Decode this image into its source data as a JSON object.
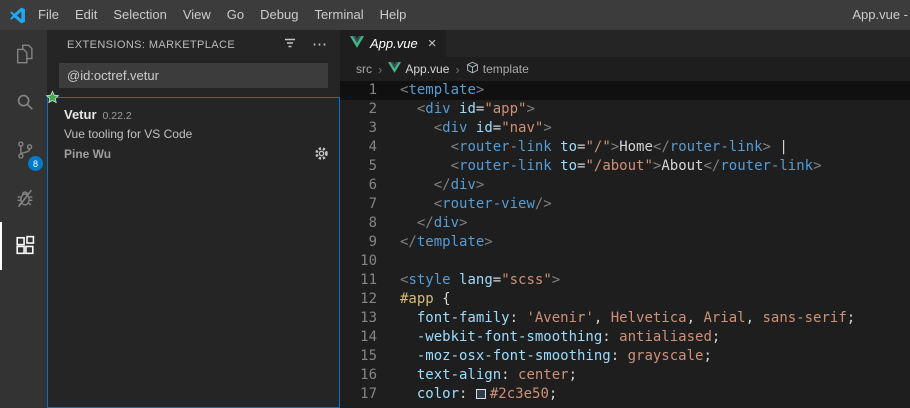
{
  "window": {
    "title": "App.vue -"
  },
  "menu": {
    "items": [
      "File",
      "Edit",
      "Selection",
      "View",
      "Go",
      "Debug",
      "Terminal",
      "Help"
    ]
  },
  "activity_bar": {
    "items": [
      "explorer",
      "search",
      "source-control",
      "debug",
      "extensions"
    ],
    "active_item": "extensions",
    "source_control_badge": "8"
  },
  "sidebar": {
    "title": "EXTENSIONS: MARKETPLACE",
    "search_value": "@id:octref.vetur",
    "extension": {
      "name": "Vetur",
      "version": "0.22.2",
      "description": "Vue tooling for VS Code",
      "author": "Pine Wu"
    }
  },
  "ui_glyphs": {
    "more": "⋯",
    "close": "×",
    "chevron": "›"
  },
  "editor": {
    "tab_label": "App.vue",
    "breadcrumb": {
      "folder": "src",
      "file": "App.vue",
      "symbol": "template"
    },
    "lines": [
      {
        "n": "1",
        "highlight": true,
        "tokens": [
          [
            "p",
            "<"
          ],
          [
            "tag",
            "template"
          ],
          [
            "p",
            ">"
          ]
        ]
      },
      {
        "n": "2",
        "tokens": [
          [
            "pl",
            "  "
          ],
          [
            "p",
            "<"
          ],
          [
            "tag",
            "div"
          ],
          [
            "pl",
            " "
          ],
          [
            "attr",
            "id"
          ],
          [
            "pl",
            "="
          ],
          [
            "str",
            "\"app\""
          ],
          [
            "p",
            ">"
          ]
        ]
      },
      {
        "n": "3",
        "tokens": [
          [
            "pl",
            "    "
          ],
          [
            "p",
            "<"
          ],
          [
            "tag",
            "div"
          ],
          [
            "pl",
            " "
          ],
          [
            "attr",
            "id"
          ],
          [
            "pl",
            "="
          ],
          [
            "str",
            "\"nav\""
          ],
          [
            "p",
            ">"
          ]
        ]
      },
      {
        "n": "4",
        "tokens": [
          [
            "pl",
            "      "
          ],
          [
            "p",
            "<"
          ],
          [
            "tag",
            "router-link"
          ],
          [
            "pl",
            " "
          ],
          [
            "attr",
            "to"
          ],
          [
            "pl",
            "="
          ],
          [
            "str",
            "\"/\""
          ],
          [
            "p",
            ">"
          ],
          [
            "pl",
            "Home"
          ],
          [
            "p",
            "</"
          ],
          [
            "tag",
            "router-link"
          ],
          [
            "p",
            ">"
          ],
          [
            "pl",
            " |"
          ]
        ]
      },
      {
        "n": "5",
        "tokens": [
          [
            "pl",
            "      "
          ],
          [
            "p",
            "<"
          ],
          [
            "tag",
            "router-link"
          ],
          [
            "pl",
            " "
          ],
          [
            "attr",
            "to"
          ],
          [
            "pl",
            "="
          ],
          [
            "str",
            "\"/about\""
          ],
          [
            "p",
            ">"
          ],
          [
            "pl",
            "About"
          ],
          [
            "p",
            "</"
          ],
          [
            "tag",
            "router-link"
          ],
          [
            "p",
            ">"
          ]
        ]
      },
      {
        "n": "6",
        "tokens": [
          [
            "pl",
            "    "
          ],
          [
            "p",
            "</"
          ],
          [
            "tag",
            "div"
          ],
          [
            "p",
            ">"
          ]
        ]
      },
      {
        "n": "7",
        "tokens": [
          [
            "pl",
            "    "
          ],
          [
            "p",
            "<"
          ],
          [
            "tag",
            "router-view"
          ],
          [
            "p",
            "/>"
          ]
        ]
      },
      {
        "n": "8",
        "tokens": [
          [
            "pl",
            "  "
          ],
          [
            "p",
            "</"
          ],
          [
            "tag",
            "div"
          ],
          [
            "p",
            ">"
          ]
        ]
      },
      {
        "n": "9",
        "tokens": [
          [
            "p",
            "</"
          ],
          [
            "tag",
            "template"
          ],
          [
            "p",
            ">"
          ]
        ]
      },
      {
        "n": "10",
        "tokens": []
      },
      {
        "n": "11",
        "tokens": [
          [
            "p",
            "<"
          ],
          [
            "tag",
            "style"
          ],
          [
            "pl",
            " "
          ],
          [
            "attr",
            "lang"
          ],
          [
            "pl",
            "="
          ],
          [
            "str",
            "\"scss\""
          ],
          [
            "p",
            ">"
          ]
        ]
      },
      {
        "n": "12",
        "tokens": [
          [
            "sel",
            "#app"
          ],
          [
            "pl",
            " {"
          ]
        ]
      },
      {
        "n": "13",
        "tokens": [
          [
            "pl",
            "  "
          ],
          [
            "prop",
            "font-family"
          ],
          [
            "pl",
            ": "
          ],
          [
            "str",
            "'Avenir'"
          ],
          [
            "pl",
            ", "
          ],
          [
            "val",
            "Helvetica"
          ],
          [
            "pl",
            ", "
          ],
          [
            "val",
            "Arial"
          ],
          [
            "pl",
            ", "
          ],
          [
            "val",
            "sans-serif"
          ],
          [
            "pl",
            ";"
          ]
        ]
      },
      {
        "n": "14",
        "tokens": [
          [
            "pl",
            "  "
          ],
          [
            "prop",
            "-webkit-font-smoothing"
          ],
          [
            "pl",
            ": "
          ],
          [
            "val",
            "antialiased"
          ],
          [
            "pl",
            ";"
          ]
        ]
      },
      {
        "n": "15",
        "tokens": [
          [
            "pl",
            "  "
          ],
          [
            "prop",
            "-moz-osx-font-smoothing"
          ],
          [
            "pl",
            ": "
          ],
          [
            "val",
            "grayscale"
          ],
          [
            "pl",
            ";"
          ]
        ]
      },
      {
        "n": "16",
        "tokens": [
          [
            "pl",
            "  "
          ],
          [
            "prop",
            "text-align"
          ],
          [
            "pl",
            ": "
          ],
          [
            "val",
            "center"
          ],
          [
            "pl",
            ";"
          ]
        ]
      },
      {
        "n": "17",
        "tokens": [
          [
            "pl",
            "  "
          ],
          [
            "prop",
            "color"
          ],
          [
            "pl",
            ": "
          ],
          [
            "sw",
            "#2c3e50"
          ],
          [
            "pl",
            ";"
          ]
        ]
      }
    ]
  },
  "colors": {
    "scm_badge": "#007acc",
    "focus_border": "#0e70c0",
    "vue_green": "#41b883",
    "vue_navy": "#35495e",
    "recommendation_star": "#41a953",
    "color_swatch_value": "#2c3e50"
  }
}
